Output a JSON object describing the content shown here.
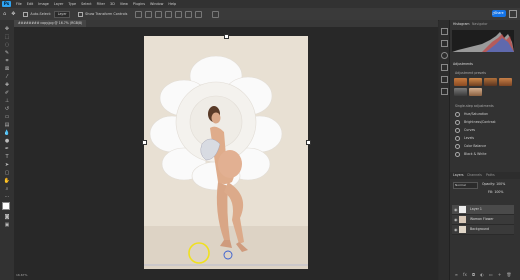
{
  "menubar": {
    "logo": "Ps",
    "items": [
      "File",
      "Edit",
      "Image",
      "Layer",
      "Type",
      "Select",
      "Filter",
      "3D",
      "View",
      "Plugins",
      "Window",
      "Help"
    ]
  },
  "options": {
    "auto_select_label": "Auto-Select:",
    "auto_select_value": "Layer",
    "show_transform_label": "Show Transform Controls",
    "share_label": "Share"
  },
  "document": {
    "tab_title": "######## copy.jpg @ 16.7% (RGB/8)",
    "status": "16.67%"
  },
  "panels": {
    "histogram_tab": "Histogram",
    "navigator_tab": "Navigator",
    "adjustments_tab": "Adjustments",
    "adjustment_presets_label": "Adjustment presets",
    "more_label": "More",
    "single_step_label": "Single-step adjustments",
    "adjustments": [
      "Hue/Saturation",
      "Brightness/Contrast",
      "Curves",
      "Levels",
      "Color Balance",
      "Black & White"
    ],
    "layers_tab": "Layers",
    "channels_tab": "Channels",
    "paths_tab": "Paths",
    "blend_mode": "Normal",
    "opacity_label": "Opacity: 100%",
    "fill_label": "Fill: 100%",
    "layers": [
      "Layer 1",
      "Woman Flower",
      "Background"
    ]
  },
  "colors": {
    "accent": "#1473e6",
    "brand": "#2ea3f2",
    "highlight_ring": "#f0e020",
    "guide_ring": "#3a5fd0"
  }
}
